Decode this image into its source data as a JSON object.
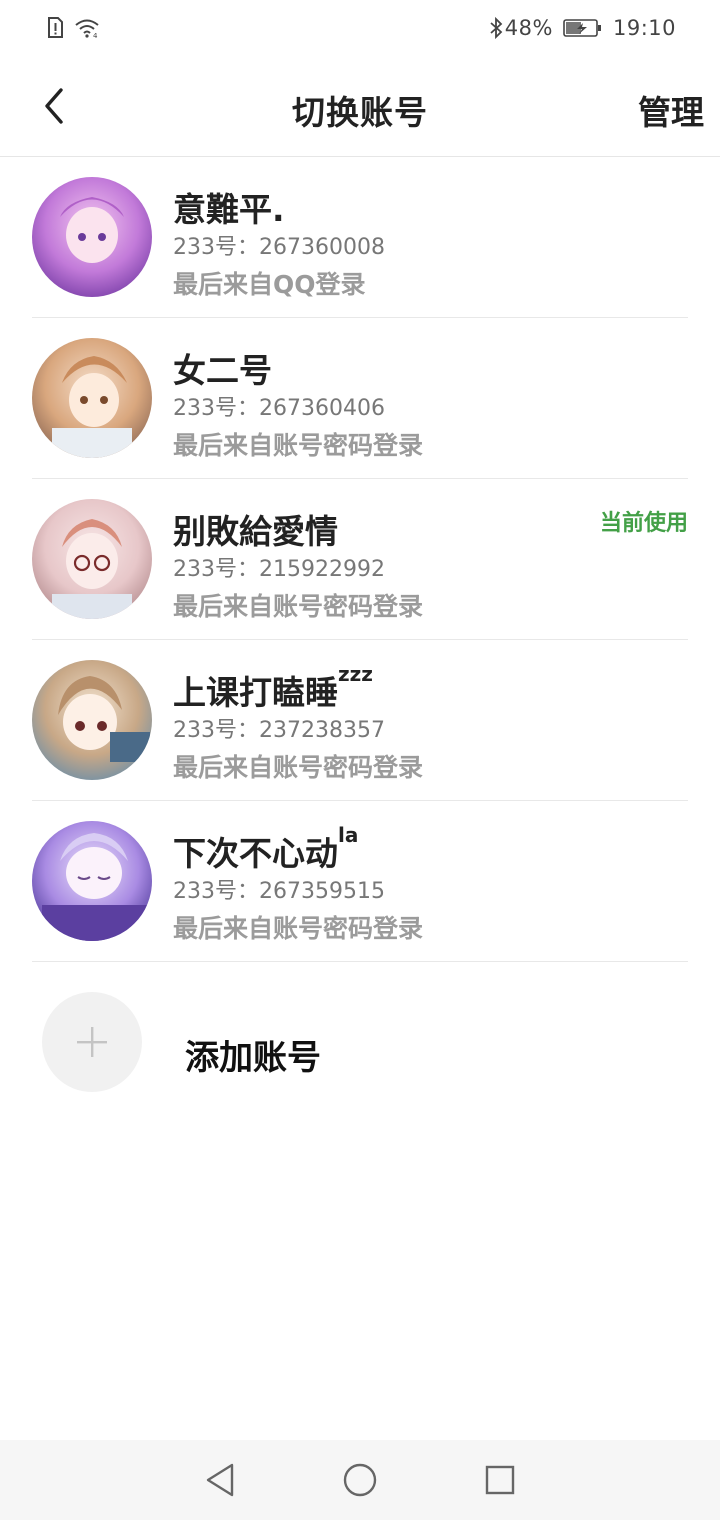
{
  "status_bar": {
    "icons": [
      "sim-alert-icon",
      "wifi-icon",
      "bluetooth-icon",
      "battery-charging-icon"
    ],
    "battery": "48%",
    "time": "19:10"
  },
  "header": {
    "back_icon": "back-arrow-icon",
    "title": "切换账号",
    "manage_label": "管理"
  },
  "accounts": [
    {
      "name": "意難平.",
      "name_sup": "",
      "id_text": "233号：267360008",
      "source": "最后来自QQ登录",
      "current": false,
      "avatar_colors": [
        "#c27ad9",
        "#f3c6f0",
        "#7a3fa8"
      ]
    },
    {
      "name": "女二号",
      "name_sup": "",
      "id_text": "233号：267360406",
      "source": "最后来自账号密码登录",
      "current": false,
      "avatar_colors": [
        "#d9a77e",
        "#f4dcc8",
        "#8f6a56"
      ]
    },
    {
      "name": "别敗給愛情",
      "name_sup": "",
      "id_text": "233号：215922992",
      "source": "最后来自账号密码登录",
      "current": true,
      "current_label": "当前使用",
      "avatar_colors": [
        "#e7c7c9",
        "#f7e6e6",
        "#b48c8f"
      ]
    },
    {
      "name": "上课打瞌睡",
      "name_sup": "zzz",
      "id_text": "233号：237238357",
      "source": "最后来自账号密码登录",
      "current": false,
      "avatar_colors": [
        "#c8a887",
        "#f2e2cf",
        "#6f8fa6"
      ]
    },
    {
      "name": "下次不心动",
      "name_sup": "la",
      "id_text": "233号：267359515",
      "source": "最后来自账号密码登录",
      "current": false,
      "avatar_colors": [
        "#a98be3",
        "#ece3fb",
        "#4f3a9b"
      ]
    }
  ],
  "add_account": {
    "icon": "plus-icon",
    "label": "添加账号"
  },
  "nav_bar": {
    "icons": [
      "nav-back-icon",
      "nav-home-icon",
      "nav-recents-icon"
    ]
  },
  "colors": {
    "current_badge": "#43a047",
    "secondary_text": "#9b9b9b",
    "divider": "#e8e8e8"
  }
}
